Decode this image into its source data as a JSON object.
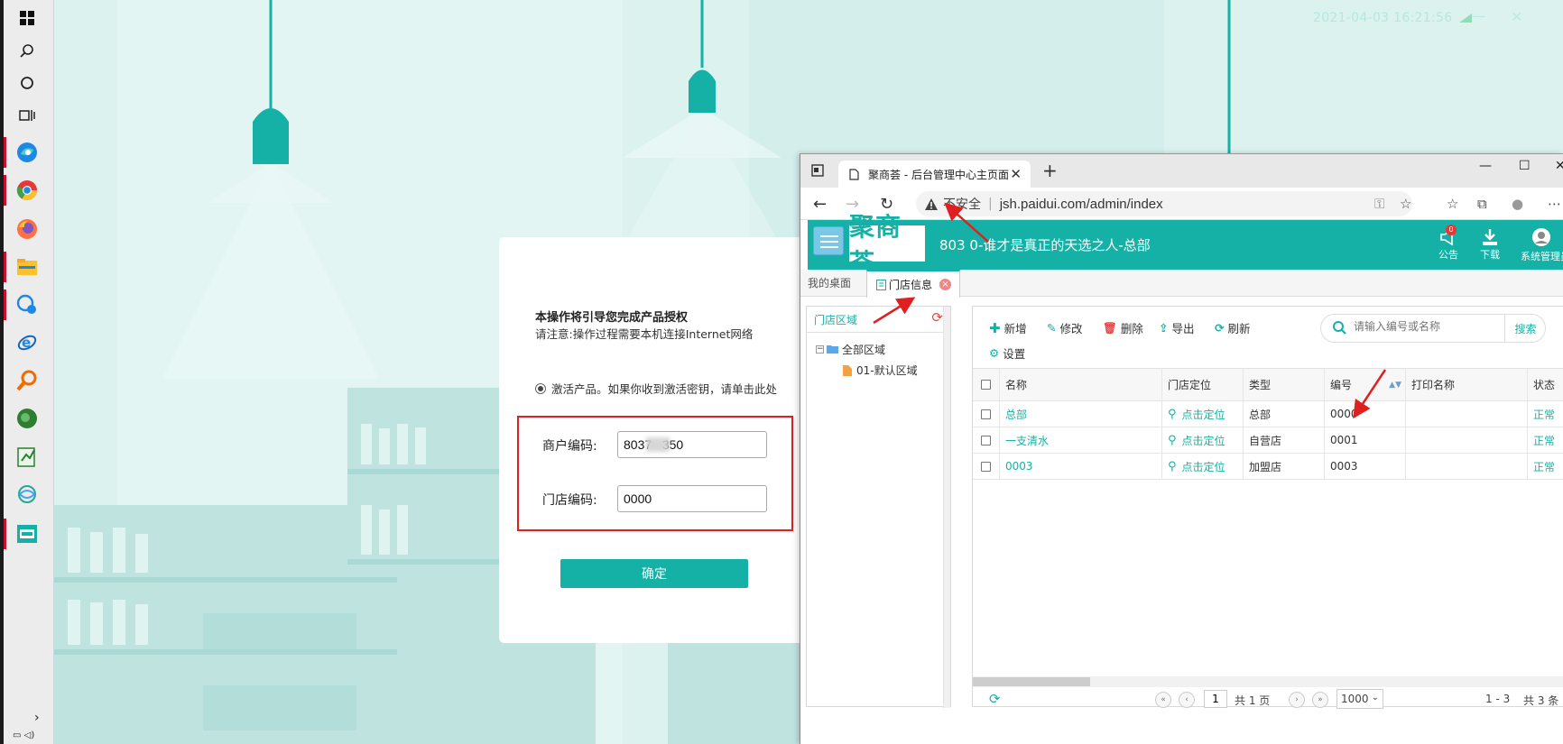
{
  "desktop": {
    "clock": "2021-04-03 16:21:56"
  },
  "taskbar": {
    "icons": [
      {
        "name": "windows-start-icon"
      },
      {
        "name": "search-icon"
      },
      {
        "name": "cortana-icon"
      },
      {
        "name": "task-view-icon"
      },
      {
        "name": "edge-icon"
      },
      {
        "name": "chrome-icon"
      },
      {
        "name": "firefox-icon"
      },
      {
        "name": "file-explorer-icon"
      },
      {
        "name": "chat-icon"
      },
      {
        "name": "ie-icon"
      },
      {
        "name": "magnifier-icon"
      },
      {
        "name": "green-app-icon"
      },
      {
        "name": "notepad-icon"
      },
      {
        "name": "network-app-icon"
      },
      {
        "name": "register-app-icon"
      }
    ]
  },
  "activation": {
    "title": "本操作将引导您完成产品授权",
    "note": "请注意:操作过程需要本机连接Internet网络",
    "radio_label": "激活产品。如果你收到激活密钥，请单击此处",
    "merchant_label": "商户编码:",
    "merchant_value": "8037   350",
    "store_label": "门店编码:",
    "store_value": "0000",
    "confirm": "确定"
  },
  "browser": {
    "tab_title": "聚商荟 - 后台管理中心主页面",
    "insecure": "不安全",
    "url": "jsh.paidui.com/admin/index"
  },
  "app": {
    "logo": "聚商荟",
    "store_header": "803     0-谁才是真正的天选之人-总部",
    "notice_label": "公告",
    "notice_badge": "0",
    "download_label": "下载",
    "user_label": "系统管理员"
  },
  "page_tabs": {
    "desk": "我的桌面",
    "store_info": "门店信息"
  },
  "region_panel": {
    "title": "门店区域",
    "tree_root": "全部区域",
    "tree_child": "01-默认区域"
  },
  "toolbar": {
    "add": "新增",
    "edit": "修改",
    "delete": "删除",
    "export": "导出",
    "refresh": "刷新",
    "settings": "设置",
    "search_placeholder": "请输入编号或名称",
    "search_button": "搜索"
  },
  "table": {
    "columns": [
      "名称",
      "门店定位",
      "类型",
      "编号",
      "打印名称",
      "状态"
    ],
    "locate_text": "点击定位",
    "rows": [
      {
        "name": "总部",
        "type": "总部",
        "code": "0000",
        "print_name": "",
        "status": "正常"
      },
      {
        "name": "一支清水",
        "type": "自营店",
        "code": "0001",
        "print_name": "",
        "status": "正常"
      },
      {
        "name": "0003",
        "type": "加盟店",
        "code": "0003",
        "print_name": "",
        "status": "正常"
      }
    ]
  },
  "pager": {
    "page": "1",
    "total_pages": "共 1 页",
    "page_size": "1000",
    "range": "1 - 3",
    "total_items": "共 3 条"
  },
  "colors": {
    "accent": "#16b1a6",
    "highlight_red": "#e02020"
  }
}
